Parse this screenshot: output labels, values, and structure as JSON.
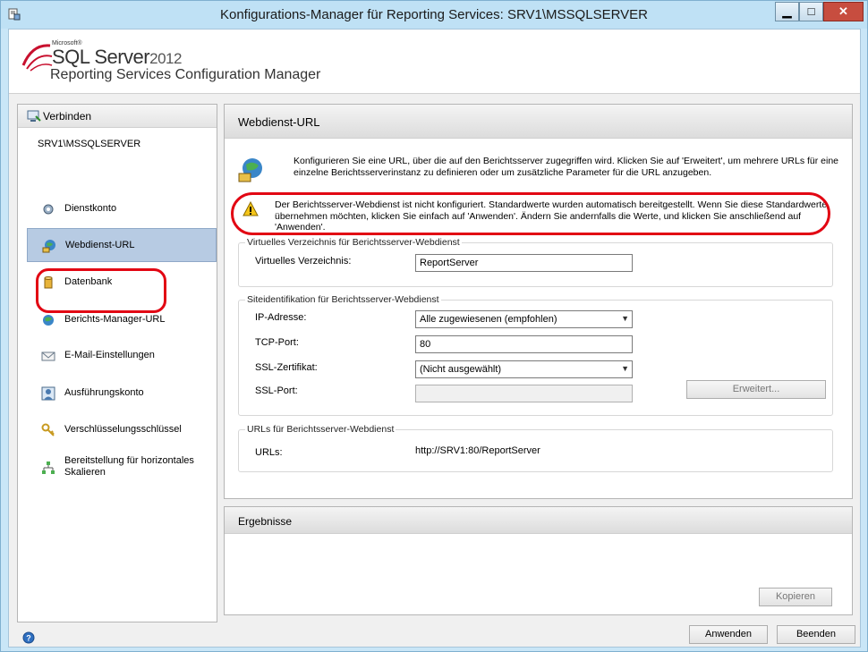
{
  "window": {
    "title": "Konfigurations-Manager für Reporting Services: SRV1\\MSSQLSERVER",
    "minimize_glyph": "▁",
    "maximize_glyph": "□",
    "close_glyph": "✕"
  },
  "branding": {
    "microsoft": "Microsoft®",
    "product": "SQL Server",
    "version": "2012",
    "subproduct": "Reporting Services Configuration Manager"
  },
  "nav": {
    "connect_label": "Verbinden",
    "server": "SRV1\\MSSQLSERVER",
    "items": [
      {
        "label": "Dienstkonto",
        "icon": "service-account-icon"
      },
      {
        "label": "Webdienst-URL",
        "icon": "web-service-icon"
      },
      {
        "label": "Datenbank",
        "icon": "database-icon"
      },
      {
        "label": "Berichts-Manager-URL",
        "icon": "globe-icon"
      },
      {
        "label": "E-Mail-Einstellungen",
        "icon": "email-icon"
      },
      {
        "label": "Ausführungskonto",
        "icon": "user-icon"
      },
      {
        "label": "Verschlüsselungsschlüssel",
        "icon": "key-icon"
      },
      {
        "label": "Bereitstellung für horizontales Skalieren",
        "icon": "network-icon"
      }
    ]
  },
  "main": {
    "title": "Webdienst-URL",
    "intro": "Konfigurieren Sie eine URL, über die auf den Berichtsserver zugegriffen wird. Klicken Sie auf 'Erweitert', um mehrere URLs für eine einzelne Berichtsserverinstanz zu definieren oder um zusätzliche Parameter für die URL anzugeben.",
    "warning": "Der Berichtsserver-Webdienst ist nicht konfiguriert. Standardwerte wurden automatisch bereitgestellt. Wenn Sie diese Standardwerte übernehmen möchten, klicken Sie einfach auf 'Anwenden'. Ändern Sie andernfalls die Werte, und klicken Sie anschließend auf 'Anwenden'.",
    "vdir_group": {
      "legend": "Virtuelles Verzeichnis für Berichtsserver-Webdienst",
      "label": "Virtuelles Verzeichnis:",
      "value": "ReportServer"
    },
    "site_group": {
      "legend": "Siteidentifikation für Berichtsserver-Webdienst",
      "ip_label": "IP-Adresse:",
      "ip_value": "Alle zugewiesenen (empfohlen)",
      "tcp_label": "TCP-Port:",
      "tcp_value": "80",
      "ssl_cert_label": "SSL-Zertifikat:",
      "ssl_cert_value": "(Nicht ausgewählt)",
      "ssl_port_label": "SSL-Port:",
      "ssl_port_value": "",
      "advanced_label": "Erweitert..."
    },
    "urls_group": {
      "legend": "URLs für Berichtsserver-Webdienst",
      "label": "URLs:",
      "value": "http://SRV1:80/ReportServer"
    }
  },
  "results": {
    "title": "Ergebnisse",
    "copy_label": "Kopieren"
  },
  "footer": {
    "apply_label": "Anwenden",
    "exit_label": "Beenden"
  },
  "colors": {
    "highlight_red": "#e20613",
    "selection": "#b7cbe3",
    "window_frame": "#c9e6f7"
  }
}
